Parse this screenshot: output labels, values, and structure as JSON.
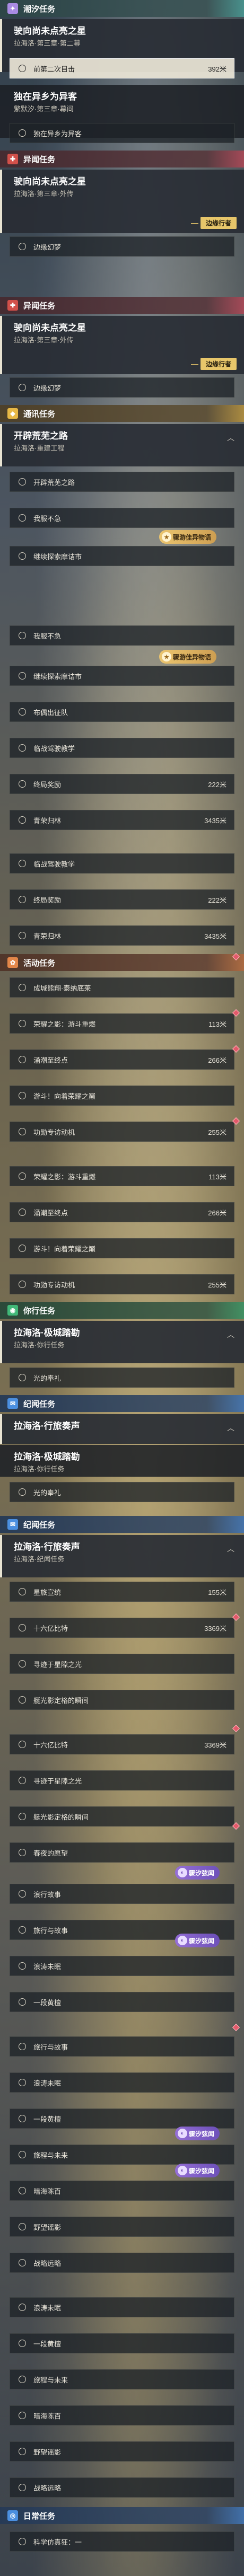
{
  "sections": {
    "main1": {
      "label": "潮汐任务"
    },
    "odd1": {
      "label": "异闻任务"
    },
    "odd2": {
      "label": "异闻任务"
    },
    "explore": {
      "label": "通讯任务"
    },
    "event": {
      "label": "活动任务"
    },
    "daily_side": {
      "label": "你行任务"
    },
    "side": {
      "label": "纪闻任务"
    },
    "side2": {
      "label": "纪闻任务"
    },
    "daily": {
      "label": "日常任务"
    }
  },
  "cards": {
    "c1": {
      "title": "驶向尚未点亮之星",
      "sub": "拉海洛·第三章·第二幕"
    },
    "c2": {
      "title": "独在异乡为异客",
      "sub": "繁默汐·第三章·幕间"
    },
    "c3": {
      "title": "驶向尚未点亮之星",
      "sub": "拉海洛·第三章·外传",
      "badge": "边缘行者"
    },
    "c4": {
      "title": "驶向尚未点亮之星",
      "sub": "拉海洛·第三章·外传",
      "badge": "边缘行者"
    },
    "c5": {
      "title": "开辟荒芜之路",
      "sub": "拉海洛·重建工程"
    },
    "c6": {
      "title": "拉海洛·极城踏勘",
      "sub": "拉海洛·你行任务"
    },
    "c7": {
      "title": "拉海洛·行旅奏声",
      "sub": ""
    },
    "c8": {
      "title": "拉海洛·极城踏勘",
      "sub": "拉海洛·你行任务"
    },
    "c9": {
      "title": "拉海洛·行旅奏声",
      "sub": "拉海洛·纪闻任务"
    }
  },
  "steps": {
    "s1": {
      "label": "前第二次目击",
      "dist": "392米"
    },
    "s2": {
      "label": "独在异乡为异客",
      "dist": ""
    },
    "s3": {
      "label": "边缘幻梦",
      "dist": ""
    },
    "s4": {
      "label": "边缘幻梦",
      "dist": ""
    },
    "s5": {
      "label": "开辟荒芜之路",
      "dist": ""
    },
    "s6": {
      "label": "我服不急",
      "dist": ""
    },
    "s7": {
      "label": "继续探索摩诘市",
      "dist": ""
    },
    "s8": {
      "label": "我服不急",
      "dist": ""
    },
    "s9": {
      "label": "继续探索摩诘市",
      "dist": ""
    },
    "s10": {
      "label": "布偶出征队",
      "dist": ""
    },
    "s11": {
      "label": "临战驾驶教学",
      "dist": ""
    },
    "s12": {
      "label": "终局奖励",
      "dist": "222米"
    },
    "s13": {
      "label": "青荣归林",
      "dist": "3435米"
    },
    "s14": {
      "label": "临战驾驶教学",
      "dist": ""
    },
    "s15": {
      "label": "终局奖励",
      "dist": "222米"
    },
    "s16": {
      "label": "青荣归林",
      "dist": "3435米"
    },
    "s17": {
      "label": "成城熊翔·泰纳底莱",
      "dist": ""
    },
    "s18": {
      "label": "荣耀之影：游斗重燃",
      "dist": "113米"
    },
    "s19": {
      "label": "涌潮至终点",
      "dist": "266米"
    },
    "s20": {
      "label": "游斗！向着荣耀之巅",
      "dist": ""
    },
    "s21": {
      "label": "功勋专访动机",
      "dist": "255米"
    },
    "s22": {
      "label": "荣耀之影：游斗重燃",
      "dist": "113米"
    },
    "s23": {
      "label": "涌潮至终点",
      "dist": "266米"
    },
    "s24": {
      "label": "游斗！向着荣耀之巅",
      "dist": ""
    },
    "s25": {
      "label": "功勋专访动机",
      "dist": "255米"
    },
    "s26": {
      "label": "光的奉礼",
      "dist": ""
    },
    "s27": {
      "label": "光的奉礼",
      "dist": ""
    },
    "s28": {
      "label": "星旅宣统",
      "dist": "155米"
    },
    "s29": {
      "label": "十六亿比特",
      "dist": "3369米"
    },
    "s30": {
      "label": "寻迹于星隙之光",
      "dist": ""
    },
    "s31": {
      "label": "艇光影定格的瞬间",
      "dist": ""
    },
    "s32": {
      "label": "十六亿比特",
      "dist": "3369米"
    },
    "s33": {
      "label": "寻迹于星隙之光",
      "dist": ""
    },
    "s34": {
      "label": "艇光影定格的瞬间",
      "dist": ""
    },
    "s35": {
      "label": "春夜的愿望",
      "dist": ""
    },
    "s36": {
      "label": "浪行故事",
      "dist": ""
    },
    "s37": {
      "label": "旅行与故事",
      "dist": ""
    },
    "s38": {
      "label": "浪涛未眠",
      "dist": ""
    },
    "s39": {
      "label": "一段黄檀",
      "dist": ""
    },
    "s40": {
      "label": "旅行与故事",
      "dist": ""
    },
    "s41": {
      "label": "浪涛未眠",
      "dist": ""
    },
    "s42": {
      "label": "一段黄檀",
      "dist": ""
    },
    "s43": {
      "label": "旅程与未来",
      "dist": ""
    },
    "s44": {
      "label": "暗海陈百",
      "dist": ""
    },
    "s45": {
      "label": "野望谣影",
      "dist": ""
    },
    "s46": {
      "label": "战略远略",
      "dist": ""
    },
    "s47": {
      "label": "浪涛未眠",
      "dist": ""
    },
    "s48": {
      "label": "一段黄檀",
      "dist": ""
    },
    "s49": {
      "label": "旅程与未来",
      "dist": ""
    },
    "s50": {
      "label": "暗海陈百",
      "dist": ""
    },
    "s51": {
      "label": "野望谣影",
      "dist": ""
    },
    "s52": {
      "label": "战略远略",
      "dist": ""
    },
    "s53": {
      "label": "科学仿真狂：一",
      "dist": ""
    }
  },
  "tags": {
    "t1": "骤汐弦闻",
    "t2": "骤汐弦闻",
    "t3": "骤汐弦闻",
    "t4": "骤汐弦闻",
    "g1": "骤游佳异物语",
    "g2": "骤游佳异物语"
  },
  "icons": {
    "header": "quest-type-icon",
    "step": "circle-icon",
    "tag": "tide-icon"
  }
}
